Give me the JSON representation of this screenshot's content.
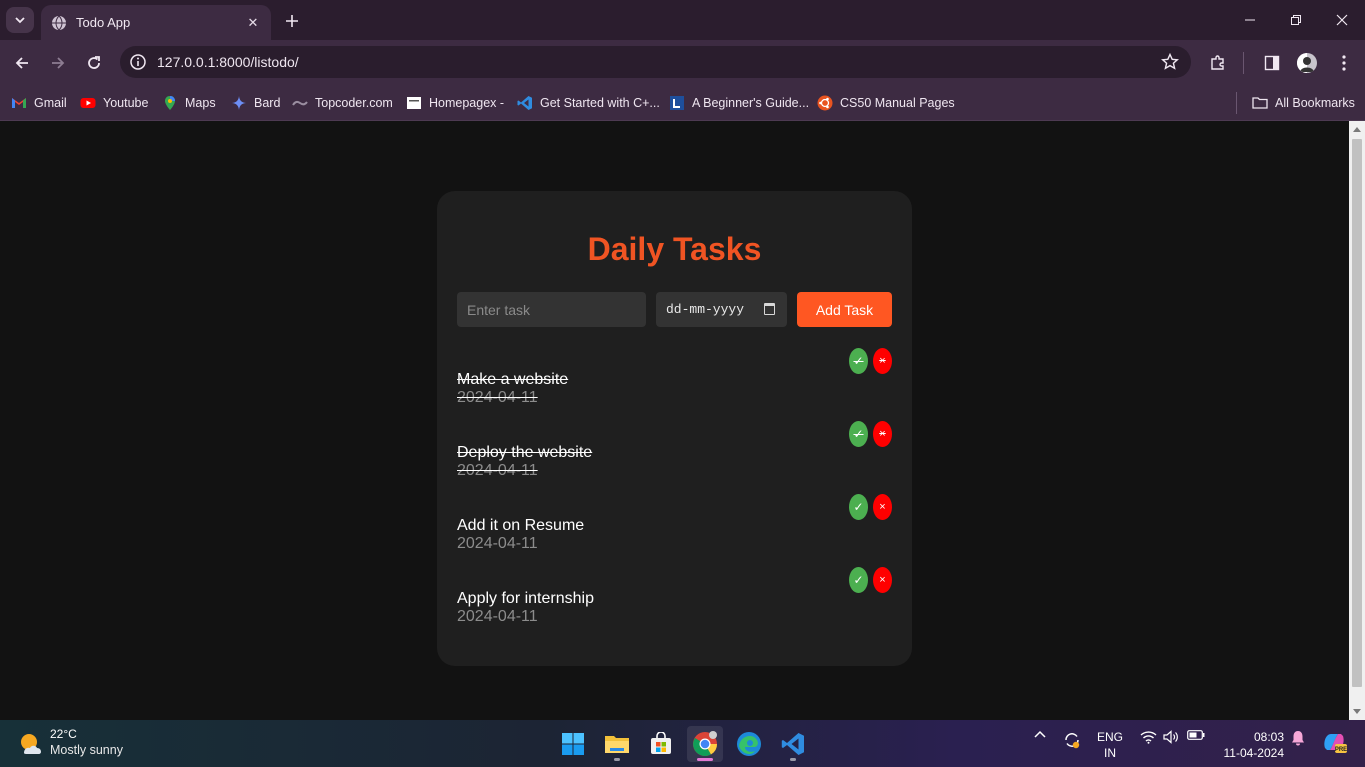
{
  "browser": {
    "tab_title": "Todo App",
    "url": "127.0.0.1:8000/listodo/",
    "bookmarks": [
      {
        "label": "Gmail"
      },
      {
        "label": "Youtube"
      },
      {
        "label": "Maps"
      },
      {
        "label": "Bard"
      },
      {
        "label": "Topcoder.com"
      },
      {
        "label": "Homepagex -"
      },
      {
        "label": "Get Started with C+..."
      },
      {
        "label": "A Beginner's Guide..."
      },
      {
        "label": "CS50 Manual Pages"
      }
    ],
    "all_bookmarks": "All Bookmarks"
  },
  "app": {
    "title": "Daily Tasks",
    "task_placeholder": "Enter task",
    "date_placeholder": "dd-mm-yyyy",
    "add_button": "Add Task",
    "check_symbol": "✓",
    "delete_symbol": "×",
    "tasks": [
      {
        "text": "Make a website",
        "date": "2024-04-11",
        "completed": true
      },
      {
        "text": "Deploy the website",
        "date": "2024-04-11",
        "completed": true
      },
      {
        "text": "Add it on Resume",
        "date": "2024-04-11",
        "completed": false
      },
      {
        "text": "Apply for internship",
        "date": "2024-04-11",
        "completed": false
      }
    ],
    "colors": {
      "accent": "#ff5722",
      "title": "#f05423",
      "check": "#4caf50",
      "delete": "#ff0000",
      "card": "#1f1f1f",
      "page": "#121212"
    }
  },
  "taskbar": {
    "temperature": "22°C",
    "weather": "Mostly sunny",
    "language_line1": "ENG",
    "language_line2": "IN",
    "time": "08:03",
    "date": "11-04-2024"
  }
}
